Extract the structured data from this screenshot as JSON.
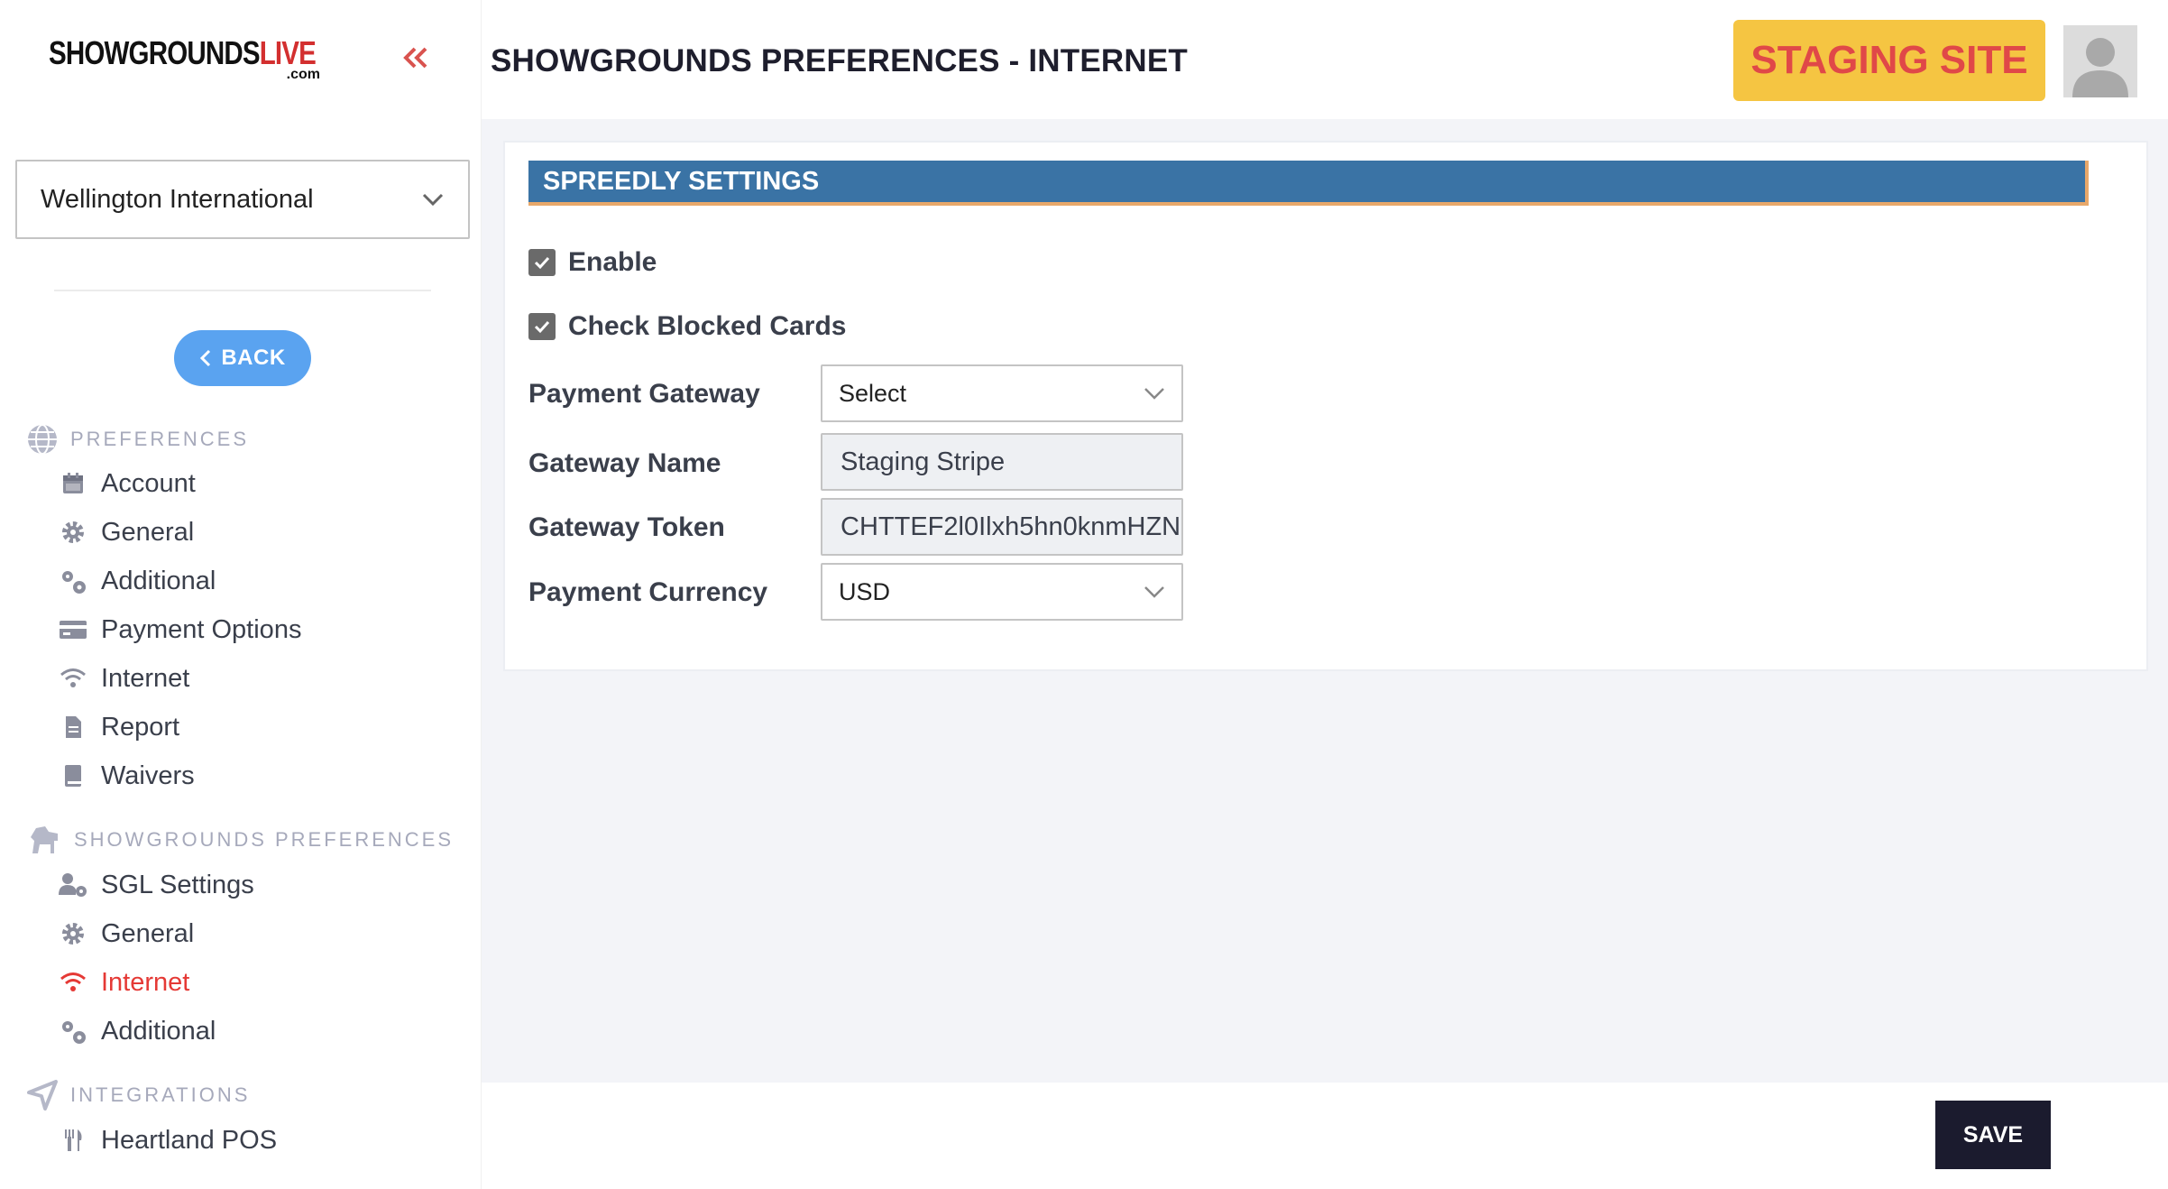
{
  "brand": {
    "logo_text_main": "SHOWGROUNDS",
    "logo_text_accent": "LIVE",
    "logo_text_sub": ".com"
  },
  "sidebar": {
    "company_select_value": "Wellington International",
    "back_label": "BACK",
    "sections": [
      {
        "label": "PREFERENCES",
        "icon": "globe-icon",
        "items": [
          {
            "label": "Account",
            "icon": "calendar-icon"
          },
          {
            "label": "General",
            "icon": "gear-icon"
          },
          {
            "label": "Additional",
            "icon": "gears-icon"
          },
          {
            "label": "Payment Options",
            "icon": "credit-card-icon"
          },
          {
            "label": "Internet",
            "icon": "wifi-icon"
          },
          {
            "label": "Report",
            "icon": "file-icon"
          },
          {
            "label": "Waivers",
            "icon": "book-icon"
          }
        ]
      },
      {
        "label": "SHOWGROUNDS PREFERENCES",
        "icon": "horse-icon",
        "items": [
          {
            "label": "SGL Settings",
            "icon": "user-gear-icon"
          },
          {
            "label": "General",
            "icon": "gear-icon"
          },
          {
            "label": "Internet",
            "icon": "wifi-icon",
            "active": true
          },
          {
            "label": "Additional",
            "icon": "gears-icon"
          }
        ]
      },
      {
        "label": "INTEGRATIONS",
        "icon": "location-arrow-icon",
        "items": [
          {
            "label": "Heartland POS",
            "icon": "utensils-icon"
          }
        ]
      }
    ]
  },
  "header": {
    "title": "SHOWGROUNDS PREFERENCES - INTERNET",
    "staging_label": "STAGING SITE"
  },
  "spreedly": {
    "heading": "SPREEDLY SETTINGS",
    "enable_label": "Enable",
    "enable_checked": true,
    "blocked_label": "Check Blocked Cards",
    "blocked_checked": true,
    "gateway_label": "Payment Gateway",
    "gateway_value": "Select",
    "gateway_name_label": "Gateway Name",
    "gateway_name_value": "Staging Stripe",
    "gateway_token_label": "Gateway Token",
    "gateway_token_value": "CHTTEF2l0Ilxh5hn0knmHZN",
    "currency_label": "Payment Currency",
    "currency_value": "USD"
  },
  "footer": {
    "save_label": "SAVE"
  },
  "colors": {
    "accent_blue": "#3a73a5",
    "staging_bg": "#f5c542",
    "staging_text": "#e04848",
    "active_nav": "#e53935",
    "back_button": "#5aa3f0",
    "save_button": "#1b1b2e"
  }
}
